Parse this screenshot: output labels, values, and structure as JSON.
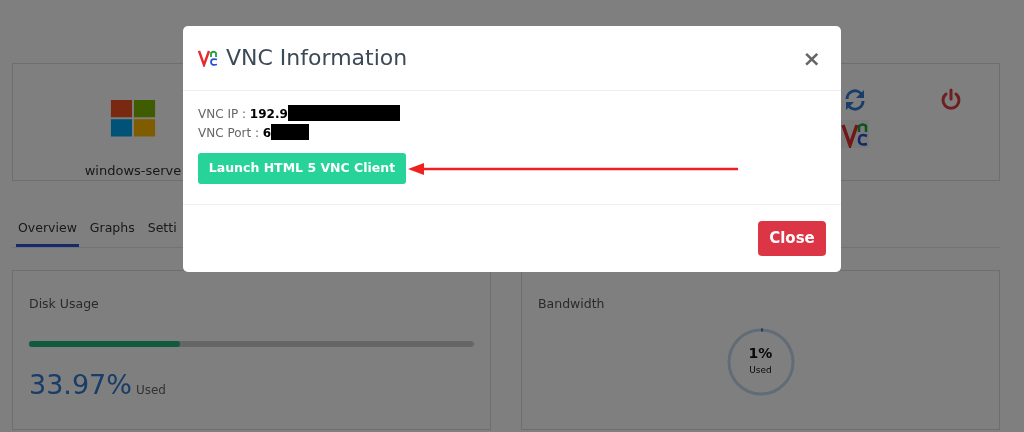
{
  "page": {
    "host": {
      "name": "windows-serve"
    },
    "tabs": [
      {
        "label": "Overview",
        "selected": true
      },
      {
        "label": "Graphs",
        "selected": false
      },
      {
        "label": "Setti",
        "selected": false
      }
    ],
    "disk": {
      "title": "Disk Usage",
      "level": 0.3397,
      "value": "33.97%",
      "unit": "Used"
    },
    "bandwidth": {
      "title": "Bandwidth",
      "level": 0.01,
      "value": "1%",
      "unit": "Used"
    }
  },
  "modal": {
    "title": "VNC Information",
    "dismiss": "×",
    "fields": [
      {
        "label": "VNC IP :",
        "value": "192.9"
      },
      {
        "label": "VNC Port :",
        "value": "6"
      }
    ],
    "launch_button": "Launch HTML 5 VNC Client",
    "close_button": "Close"
  }
}
